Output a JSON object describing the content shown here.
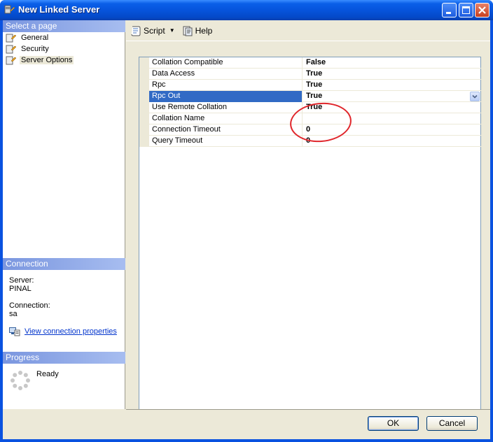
{
  "window": {
    "title": "New Linked Server"
  },
  "left_panel": {
    "select_page_header": "Select a page",
    "pages": [
      {
        "label": "General",
        "selected": false
      },
      {
        "label": "Security",
        "selected": false
      },
      {
        "label": "Server Options",
        "selected": true
      }
    ],
    "connection_header": "Connection",
    "server_label": "Server:",
    "server_value": "PINAL",
    "connection_label": "Connection:",
    "connection_value": "sa",
    "view_connection_link": "View connection properties",
    "progress_header": "Progress",
    "progress_status": "Ready"
  },
  "toolbar": {
    "script_label": "Script",
    "help_label": "Help"
  },
  "properties": [
    {
      "name": "Collation Compatible",
      "value": "False"
    },
    {
      "name": "Data Access",
      "value": "True"
    },
    {
      "name": "Rpc",
      "value": "True"
    },
    {
      "name": "Rpc Out",
      "value": "True",
      "selected": true
    },
    {
      "name": "Use Remote Collation",
      "value": "True"
    },
    {
      "name": "Collation Name",
      "value": ""
    },
    {
      "name": "Connection Timeout",
      "value": "0"
    },
    {
      "name": "Query Timeout",
      "value": "0"
    }
  ],
  "buttons": {
    "ok": "OK",
    "cancel": "Cancel"
  },
  "colors": {
    "title_bar": "#0654dc",
    "selected_row": "#316ac5",
    "annotation_circle": "#e0262b"
  }
}
